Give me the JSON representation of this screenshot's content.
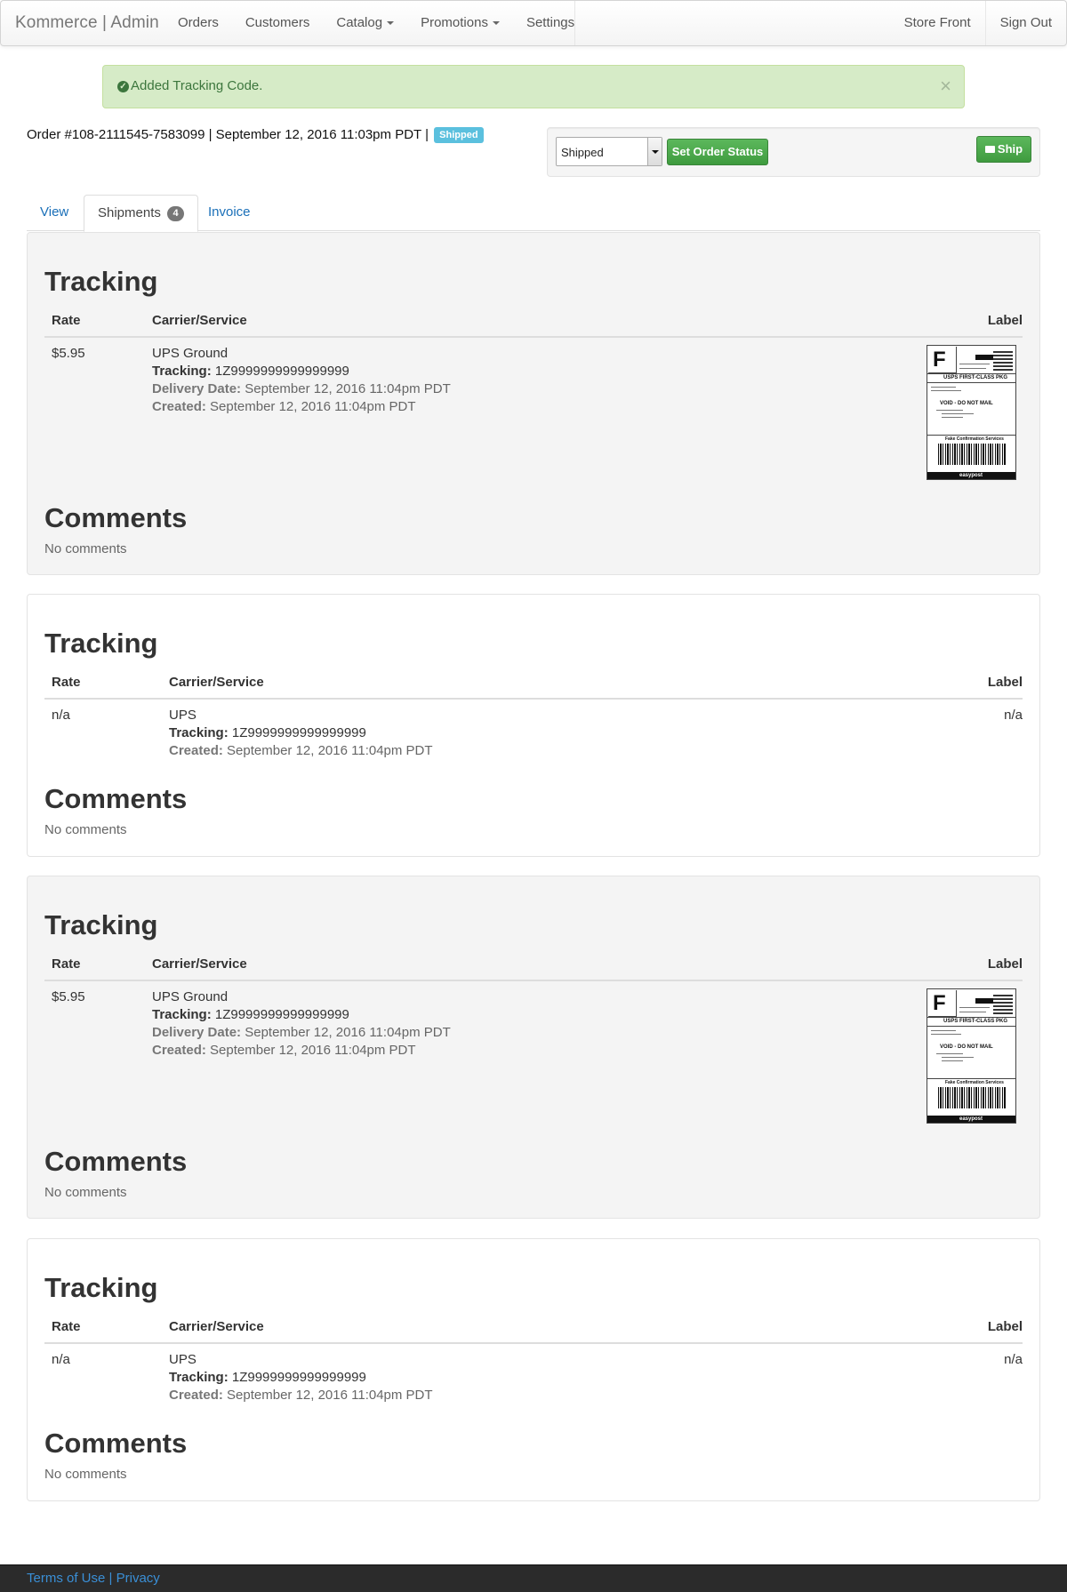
{
  "navbar": {
    "brand": "Kommerce | Admin",
    "items": [
      {
        "label": "Orders"
      },
      {
        "label": "Customers"
      },
      {
        "label": "Catalog"
      },
      {
        "label": "Promotions"
      },
      {
        "label": "Settings"
      }
    ],
    "right_items": [
      {
        "label": "Store Front"
      },
      {
        "label": "Sign Out"
      }
    ]
  },
  "alert": {
    "message": "Added Tracking Code.",
    "close": "×"
  },
  "order": {
    "title": "Order #108-2111545-7583099 | September 12, 2016 11:03pm PDT |",
    "status_badge": "Shipped",
    "status_select_value": "Shipped",
    "set_status_label": "Set Order Status",
    "ship_label": "Ship"
  },
  "tabs": [
    {
      "label": "View"
    },
    {
      "label": "Shipments",
      "count": "4"
    },
    {
      "label": "Invoice"
    }
  ],
  "shipments": [
    {
      "tracking_heading": "Tracking",
      "columns": {
        "rate": "Rate",
        "carrier": "Carrier/Service",
        "label": "Label"
      },
      "rate": "$5.95",
      "carrier": "UPS Ground",
      "tracking_label": "Tracking:",
      "tracking_number": "1Z9999999999999999",
      "delivery_label": "Delivery Date:",
      "delivery_value": "September 12, 2016 11:04pm PDT",
      "created_label": "Created:",
      "created_value": "September 12, 2016 11:04pm PDT",
      "label_value": "",
      "comments_heading": "Comments",
      "comments": "No comments"
    },
    {
      "tracking_heading": "Tracking",
      "columns": {
        "rate": "Rate",
        "carrier": "Carrier/Service",
        "label": "Label"
      },
      "rate": "n/a",
      "carrier": "UPS",
      "tracking_label": "Tracking:",
      "tracking_number": "1Z9999999999999999",
      "created_label": "Created:",
      "created_value": "September 12, 2016 11:04pm PDT",
      "label_value": "n/a",
      "comments_heading": "Comments",
      "comments": "No comments"
    },
    {
      "tracking_heading": "Tracking",
      "columns": {
        "rate": "Rate",
        "carrier": "Carrier/Service",
        "label": "Label"
      },
      "rate": "$5.95",
      "carrier": "UPS Ground",
      "tracking_label": "Tracking:",
      "tracking_number": "1Z9999999999999999",
      "delivery_label": "Delivery Date:",
      "delivery_value": "September 12, 2016 11:04pm PDT",
      "created_label": "Created:",
      "created_value": "September 12, 2016 11:04pm PDT",
      "label_value": "",
      "comments_heading": "Comments",
      "comments": "No comments"
    },
    {
      "tracking_heading": "Tracking",
      "columns": {
        "rate": "Rate",
        "carrier": "Carrier/Service",
        "label": "Label"
      },
      "rate": "n/a",
      "carrier": "UPS",
      "tracking_label": "Tracking:",
      "tracking_number": "1Z9999999999999999",
      "created_label": "Created:",
      "created_value": "September 12, 2016 11:04pm PDT",
      "label_value": "n/a",
      "comments_heading": "Comments",
      "comments": "No comments"
    }
  ],
  "shipping_label_image": {
    "letter": "F",
    "service": "USPS FIRST-CLASS PKG",
    "void_text": "VOID - DO NOT MAIL",
    "barcode_caption": "Fake Confirmation Services",
    "brand": "easypost"
  },
  "footer": {
    "terms": "Terms of Use",
    "separator": "|",
    "privacy": "Privacy"
  },
  "colors": {
    "link": "#1a6fb8",
    "success_bg": "#d6ebc7",
    "success_text": "#3c763d",
    "button_green": "#5cb85c",
    "badge_info": "#5bc0de",
    "well_grey": "#f4f4f4",
    "footer_bg": "#2b2b2b",
    "footer_link": "#3a8fd6"
  }
}
